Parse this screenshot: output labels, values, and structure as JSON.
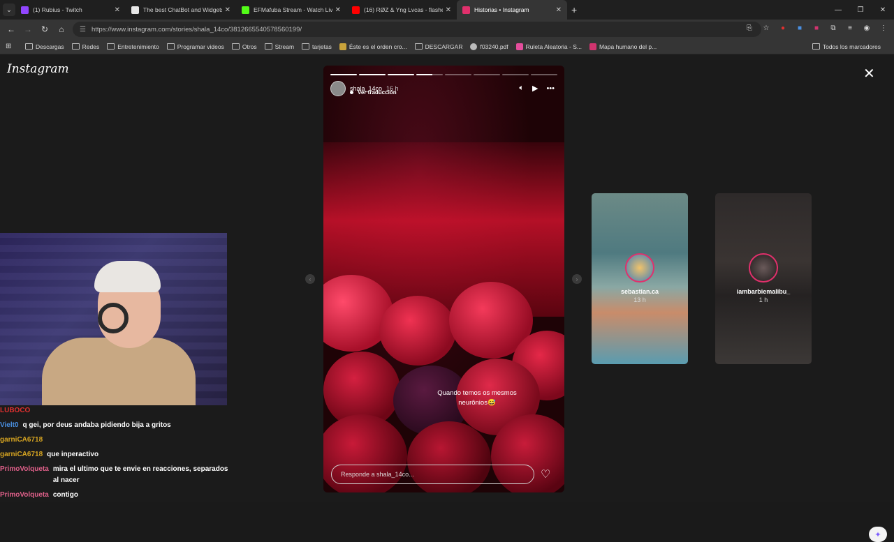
{
  "tabs": [
    {
      "label": "(1) Rubius - Twitch",
      "favicon_color": "#9146ff",
      "active": false
    },
    {
      "label": "The best ChatBot and Widgets",
      "favicon_color": "#e8e8e8",
      "active": false
    },
    {
      "label": "EFMafuba Stream - Watch Live",
      "favicon_color": "#53fc18",
      "active": false
    },
    {
      "label": "(16) RØZ & Yng Lvcas - flashes",
      "favicon_color": "#ff0000",
      "active": false
    },
    {
      "label": "Historias • Instagram",
      "favicon_color": "#e1306c",
      "active": true
    }
  ],
  "url": "https://www.instagram.com/stories/shala_14co/3812665540578560199/",
  "bookmarks": [
    {
      "label": "Descargas",
      "type": "folder"
    },
    {
      "label": "Redes",
      "type": "folder"
    },
    {
      "label": "Entretenimiento",
      "type": "folder"
    },
    {
      "label": "Programar videos",
      "type": "folder"
    },
    {
      "label": "Otros",
      "type": "folder"
    },
    {
      "label": "Stream",
      "type": "folder"
    },
    {
      "label": "tarjetas",
      "type": "folder"
    },
    {
      "label": "Éste es el orden cro...",
      "type": "link",
      "color": "#c9a33b"
    },
    {
      "label": "DESCARGAR",
      "type": "folder"
    },
    {
      "label": "f03240.pdf",
      "type": "link",
      "color": "#bbbbbb"
    },
    {
      "label": "Ruleta Aleatoria - S...",
      "type": "link",
      "color": "#e44d9c"
    },
    {
      "label": "Mapa humano del p...",
      "type": "link",
      "color": "#d2346f"
    }
  ],
  "all_bookmarks": "Todos los marcadores",
  "instagram_logo": "Instagram",
  "story": {
    "username": "shala_14co",
    "time": "16 h",
    "translate": "Ver traducción",
    "caption_line1": "Quando temos os mesmos",
    "caption_line2": "neurônios😅",
    "reply_placeholder": "Responde a shala_14co...",
    "segments_done": 3,
    "segments_partial": 1,
    "segments_total": 8
  },
  "previews": [
    {
      "name": "sebastian.ca",
      "time": "13 h"
    },
    {
      "name": "iambarbiemalibu_",
      "time": "1 h"
    }
  ],
  "chat": [
    {
      "user": "LUBOCO",
      "color": "#e0302f",
      "msg": ""
    },
    {
      "user": "Vielt0",
      "color": "#4a90e2",
      "msg": "q gei, por deus andaba pidiendo bija a gritos"
    },
    {
      "user": "garniCA6718",
      "color": "#d7a521",
      "msg": ""
    },
    {
      "user": "garniCA6718",
      "color": "#d7a521",
      "msg": "que inperactivo"
    },
    {
      "user": "PrimoVolqueta",
      "color": "#e0608a",
      "msg": "mira el ultimo que te envie en reacciones, separados al nacer"
    },
    {
      "user": "PrimoVolqueta",
      "color": "#e0608a",
      "msg": "contigo"
    }
  ]
}
